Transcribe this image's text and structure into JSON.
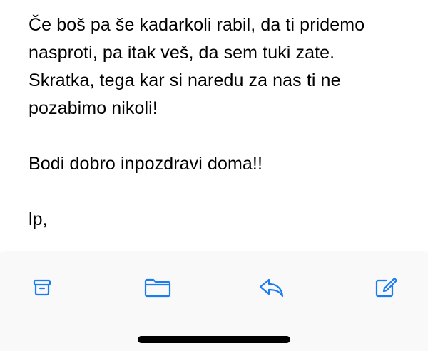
{
  "message": {
    "paragraphs": [
      {
        "lines": [
          "Če boš pa še kadarkoli rabil, da ti pridemo",
          "nasproti, pa itak veš, da sem tuki zate.",
          "Skratka, tega kar si naredu za nas ti ne",
          "pozabimo nikoli!"
        ]
      },
      {
        "lines": [
          "Bodi dobro inpozdravi doma!!"
        ]
      },
      {
        "lines": [
          "lp,"
        ]
      }
    ]
  },
  "toolbar": {
    "accent_color": "#1a7cf0",
    "buttons": [
      {
        "icon": "archive-icon"
      },
      {
        "icon": "folder-icon"
      },
      {
        "icon": "reply-icon"
      },
      {
        "icon": "compose-icon"
      }
    ]
  }
}
